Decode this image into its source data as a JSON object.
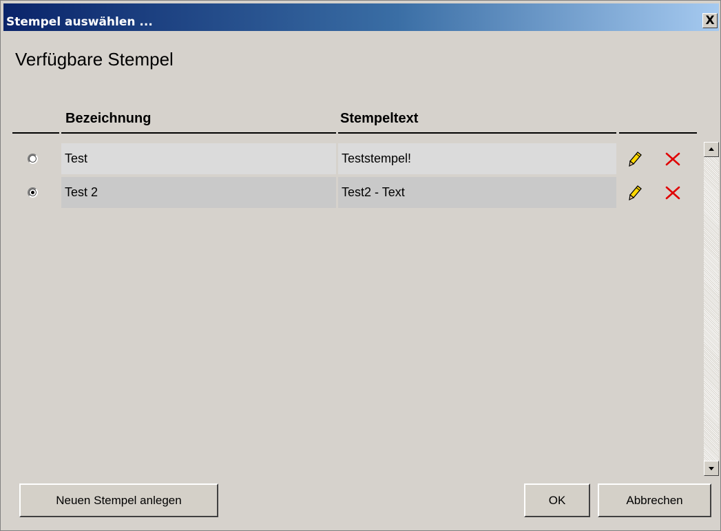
{
  "window": {
    "title": "Stempel auswählen ...",
    "close_label": "X"
  },
  "heading": "Verfügbare Stempel",
  "table": {
    "columns": [
      "Bezeichnung",
      "Stempeltext"
    ],
    "rows": [
      {
        "name": "Test",
        "text": "Teststempel!",
        "selected": false
      },
      {
        "name": "Test 2",
        "text": "Test2 - Text",
        "selected": true
      }
    ],
    "row_actions": [
      "pencil-icon",
      "delete-x-icon"
    ]
  },
  "buttons": {
    "new": "Neuen Stempel anlegen",
    "ok": "OK",
    "cancel": "Abbrechen"
  },
  "colors": {
    "titlebar_start": "#0a246a",
    "titlebar_end": "#a6caf0",
    "dialog_bg": "#d6d2cc",
    "row1_bg": "#dbdbdb",
    "row2_bg": "#c9c9c9",
    "delete_red": "#e00000"
  }
}
